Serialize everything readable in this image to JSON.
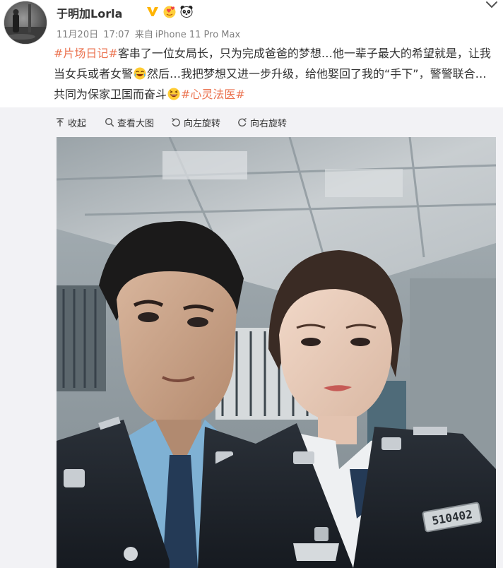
{
  "post": {
    "username": "于明加Lorla",
    "date": "11月20日",
    "time": "17:07",
    "source_prefix": "来自",
    "device": "iPhone 11 Pro Max",
    "tag_1": "#片场日记#",
    "text_1": "客串了一位女局长，只为完成爸爸的梦想…他一辈子最大的希望就是，让我当女兵或者女警",
    "text_2": "然后…我把梦想又进一步升级，给他娶回了我的“手下”，警警联合…共同为保家卫国而奋斗",
    "tag_2": "#心灵法医#"
  },
  "badges": {
    "verified": "V",
    "badge_1": "love-badge-icon",
    "badge_2": "panda-icon"
  },
  "emojis": {
    "first": "laugh-cry-emoji",
    "second": "laugh-emoji"
  },
  "toolbar": {
    "collapse": "收起",
    "view_large": "查看大图",
    "rotate_left": "向左旋转",
    "rotate_right": "向右旋转"
  },
  "photo": {
    "badge_number": "510402"
  },
  "colors": {
    "tag_orange": "#eb7350",
    "text_dark": "#333333",
    "meta_gray": "#808080",
    "verified_gold": "#ffb400",
    "panel_gray": "#f2f2f5"
  }
}
